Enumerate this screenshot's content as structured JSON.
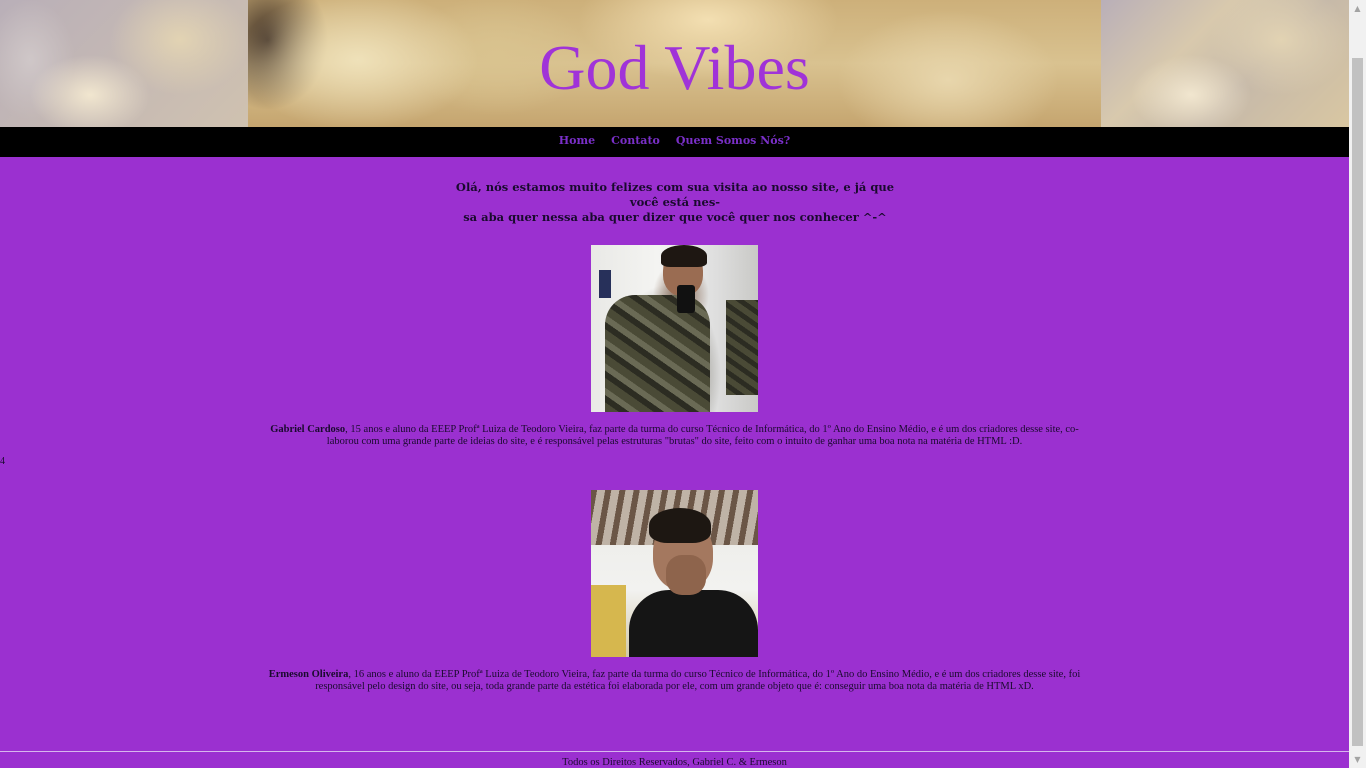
{
  "header": {
    "title": "God Vibes"
  },
  "nav": {
    "items": [
      "Home",
      "Contato",
      "Quem Somos Nós?"
    ]
  },
  "intro": {
    "line1": "Olá, nós estamos muito felizes com sua visita ao nosso site, e já que você está nes-",
    "line2": "sa aba quer nessa aba quer dizer que você quer nos conhecer ^-^"
  },
  "members": [
    {
      "name": "Gabriel Cardoso",
      "line1_rest": ", 15 anos e aluno da EEEP Profª Luiza de Teodoro Vieira, faz parte da turma do curso Técnico de Informática, do 1º Ano do Ensino Médio, e é um dos criadores desse site, co-",
      "line2": "laborou com uma grande parte de ideias do site, e é responsável pelas estruturas \"brutas\" do site, feito com o intuito de ganhar uma boa nota na matéria de HTML :D."
    },
    {
      "name": "Ermeson Oliveira",
      "line1_rest": ", 16 anos e aluno da EEEP Profª Luiza de Teodoro Vieira, faz parte da turma do curso Técnico de Informática, do 1º Ano do Ensino Médio, e é um dos criadores desse site, foi",
      "line2": "responsável pelo design do site, ou seja, toda grande parte da estética foi elaborada por ele, com um grande objeto que é: conseguir uma boa nota da matéria de HTML xD."
    }
  ],
  "stray_text": "4",
  "footer": {
    "text": "Todos os Direitos Reservados, Gabriel C. & Ermeson"
  },
  "colors": {
    "page_background": "#9b30d0",
    "title": "#a033d8",
    "nav_background": "#000000",
    "nav_link": "#7a2fc8"
  },
  "icons": {
    "scroll_up": "▲",
    "scroll_down": "▼"
  }
}
